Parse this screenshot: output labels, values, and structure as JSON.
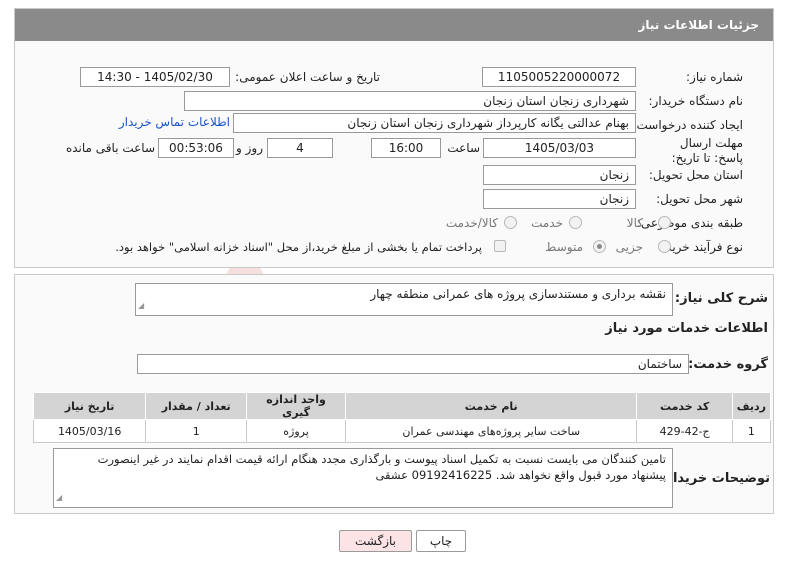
{
  "header": {
    "title": "جزئیات اطلاعات نیاز"
  },
  "fields": {
    "need_number_label": "شماره نیاز:",
    "need_number": "1105005220000072",
    "announce_label": "تاریخ و ساعت اعلان عمومی:",
    "announce_value": "1405/02/30 - 14:30",
    "buyer_org_label": "نام دستگاه خریدار:",
    "buyer_org": "شهرداری زنجان استان زنجان",
    "creator_label": "ایجاد کننده درخواست:",
    "creator": "بهنام عدالتی یگانه کارپرداز شهرداری زنجان استان زنجان",
    "contact_link": "اطلاعات تماس خریدار",
    "deadline_label": "مهلت ارسال پاسخ: تا تاریخ:",
    "deadline_date": "1405/03/03",
    "time_label": "ساعت",
    "deadline_time": "16:00",
    "days_value": "4",
    "days_label": "روز و",
    "remaining_time": "00:53:06",
    "remaining_label": "ساعت باقی مانده",
    "province_label": "استان محل تحویل:",
    "province": "زنجان",
    "city_label": "شهر محل تحویل:",
    "city": "زنجان",
    "category_label": "طبقه بندی موضوعی:",
    "category_options": [
      "کالا",
      "خدمت",
      "کالا/خدمت"
    ],
    "process_label": "نوع فرآیند خرید :",
    "process_options": [
      "جزیی",
      "متوسط"
    ],
    "payment_note": "پرداخت تمام یا بخشی از مبلغ خرید،از محل \"اسناد خزانه اسلامی\" خواهد بود."
  },
  "summary": {
    "label": "شرح کلی نیاز:",
    "value": "نقشه برداری و مستندسازی پروژه های عمرانی منطقه چهار"
  },
  "services": {
    "section_title": "اطلاعات خدمات مورد نیاز",
    "group_label": "گروه خدمت:",
    "group_value": "ساختمان",
    "columns": [
      "ردیف",
      "کد خدمت",
      "نام خدمت",
      "واحد اندازه گیری",
      "تعداد / مقدار",
      "تاریخ نیاز"
    ],
    "rows": [
      {
        "row": "1",
        "code": "ج-42-429",
        "name": "ساخت سایر پروژه‌های مهندسی عمران",
        "unit": "پروژه",
        "qty": "1",
        "date": "1405/03/16"
      }
    ]
  },
  "buyer_notes": {
    "label": "توضیحات خریدار:",
    "line1": "تامین کنندگان می بایست نسبت به تکمیل اسناد پیوست و بارگذاری مجدد هنگام ارائه قیمت اقدام نمایند در غیر اینصورت",
    "line2": "پیشنهاد مورد قبول واقع نخواهد شد. 09192416225 عشقی"
  },
  "buttons": {
    "print": "چاپ",
    "back": "بازگشت"
  },
  "colors": {
    "header_bg": "#8a8a8a",
    "link": "#1a55c9",
    "back_bg": "#fbe3e6",
    "watermark": "#e8a6a6"
  }
}
